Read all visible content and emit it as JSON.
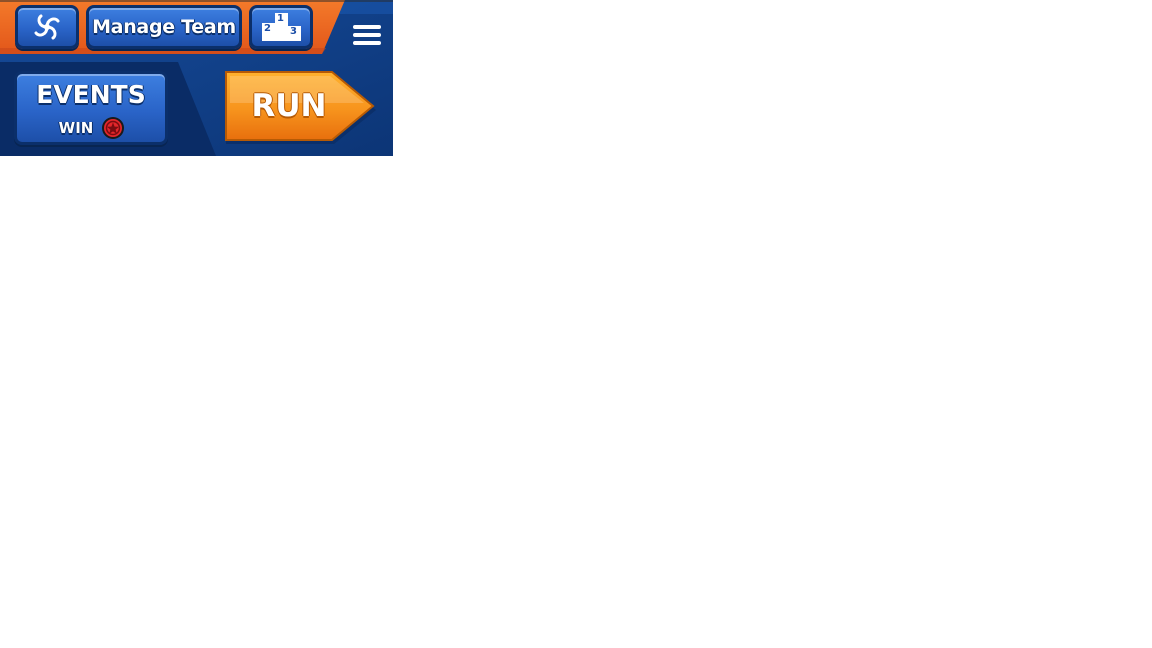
{
  "hud": {
    "top_buttons": {
      "spin_icon": "swirl-icon",
      "manage_team_label": "Manage Team",
      "leaderboard_icon": "podium-icon",
      "podium": {
        "first": "1",
        "second": "2",
        "third": "3"
      },
      "menu_icon": "hamburger-menu-icon"
    },
    "events": {
      "title": "EVENTS",
      "subtitle": "WIN",
      "reward_icon": "red-star-token-icon"
    },
    "run_button": {
      "label": "RUN"
    },
    "colors": {
      "orange_top": "#f36a1c",
      "navy_panel": "#0f3f86",
      "button_blue": "#2a64c8",
      "run_orange": "#f7941d",
      "token_red": "#e3262a"
    }
  }
}
